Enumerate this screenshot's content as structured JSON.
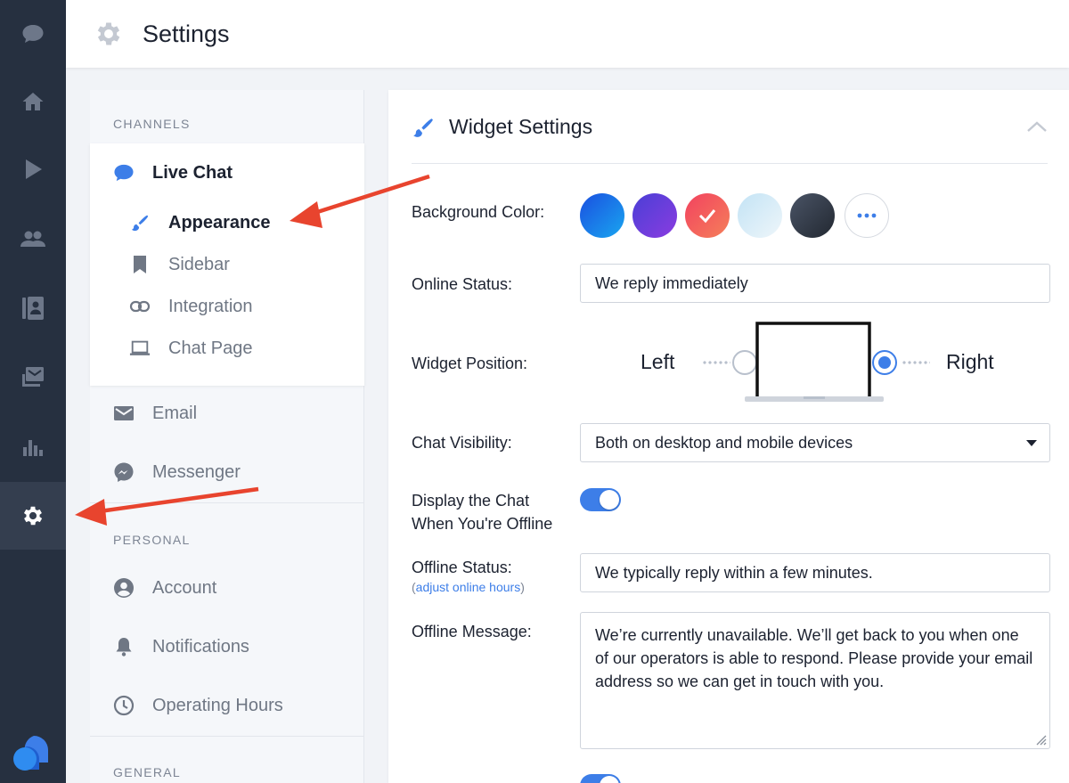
{
  "header": {
    "title": "Settings",
    "icon": "gear-icon"
  },
  "rail": {
    "items": [
      {
        "icon": "chat-bubble-icon"
      },
      {
        "icon": "home-icon"
      },
      {
        "icon": "play-icon"
      },
      {
        "icon": "people-icon"
      },
      {
        "icon": "contacts-book-icon"
      },
      {
        "icon": "inbox-icon"
      },
      {
        "icon": "bar-chart-icon"
      },
      {
        "icon": "gear-icon",
        "active": true
      }
    ],
    "logo": "brand-logo"
  },
  "subnav": {
    "channels_label": "CHANNELS",
    "live_chat": "Live Chat",
    "live_chat_items": [
      {
        "label": "Appearance",
        "icon": "paintbrush-icon",
        "active": true
      },
      {
        "label": "Sidebar",
        "icon": "bookmark-icon"
      },
      {
        "label": "Integration",
        "icon": "link-icon"
      },
      {
        "label": "Chat Page",
        "icon": "laptop-icon"
      }
    ],
    "email": "Email",
    "messenger": "Messenger",
    "personal_label": "PERSONAL",
    "personal_items": [
      {
        "label": "Account",
        "icon": "account-icon"
      },
      {
        "label": "Notifications",
        "icon": "bell-icon"
      },
      {
        "label": "Operating Hours",
        "icon": "clock-icon"
      }
    ],
    "general_label": "GENERAL"
  },
  "panel": {
    "title": "Widget Settings",
    "background_color_label": "Background Color:",
    "swatches": [
      "#1e63e8",
      "#6b3fd9",
      "#f3556b",
      "#d6ecf7",
      "#2f3642"
    ],
    "selected_swatch": 2,
    "online_status_label": "Online Status:",
    "online_status_value": "We reply immediately",
    "widget_position_label": "Widget Position:",
    "position_left": "Left",
    "position_right": "Right",
    "position_selected": "Right",
    "chat_visibility_label": "Chat Visibility:",
    "chat_visibility_value": "Both on desktop and mobile devices",
    "display_offline_label_1": "Display the Chat",
    "display_offline_label_2": "When You're Offline",
    "display_offline_on": true,
    "offline_status_label": "Offline Status:",
    "adjust_hours_link": "adjust online hours",
    "offline_status_value": "We typically reply within a few minutes.",
    "offline_message_label": "Offline Message:",
    "offline_message_value": "We’re currently unavailable. We’ll get back to you when one of our operators is able to respond. Please provide your email address so we can get in touch with you."
  },
  "colors": {
    "accent": "#3d7ee8",
    "rail_bg": "#263040",
    "annotation": "#e8442e"
  }
}
